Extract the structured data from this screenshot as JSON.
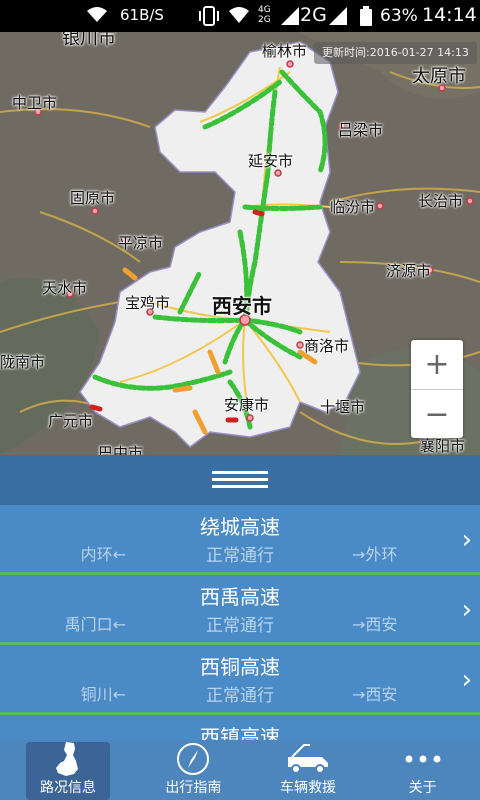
{
  "status_bar": {
    "net_speed": "61B/S",
    "network": "2G",
    "net_small": "4G\n2G",
    "battery": "63%",
    "time": "14:14"
  },
  "map": {
    "update_label": "更新时间:2016-01-27 14:13",
    "cities": [
      {
        "name": "银川市"
      },
      {
        "name": "榆林市"
      },
      {
        "name": "太原市"
      },
      {
        "name": "中卫市"
      },
      {
        "name": "吕梁市"
      },
      {
        "name": "延安市"
      },
      {
        "name": "固原市"
      },
      {
        "name": "临汾市"
      },
      {
        "name": "长治市"
      },
      {
        "name": "平凉市"
      },
      {
        "name": "济源市"
      },
      {
        "name": "天水市"
      },
      {
        "name": "宝鸡市"
      },
      {
        "name": "西安市"
      },
      {
        "name": "商洛市"
      },
      {
        "name": "陇南市"
      },
      {
        "name": "十堰市"
      },
      {
        "name": "安康市"
      },
      {
        "name": "广元市"
      },
      {
        "name": "巴中市"
      },
      {
        "name": "襄阳市"
      }
    ],
    "zoom_in": "+",
    "zoom_out": "−"
  },
  "roads": [
    {
      "name": "绕城高速",
      "from": "内环",
      "state": "正常通行",
      "to": "外环"
    },
    {
      "name": "西禹高速",
      "from": "禹门口",
      "state": "正常通行",
      "to": "西安"
    },
    {
      "name": "西铜高速",
      "from": "铜川",
      "state": "正常通行",
      "to": "西安"
    },
    {
      "name": "西镇高速",
      "from": "",
      "state": "",
      "to": ""
    }
  ],
  "tabs": [
    {
      "label": "路况信息",
      "icon": "shaanxi-map-icon",
      "active": true
    },
    {
      "label": "出行指南",
      "icon": "compass-icon",
      "active": false
    },
    {
      "label": "车辆救援",
      "icon": "tow-truck-icon",
      "active": false
    },
    {
      "label": "关于",
      "icon": "more-dots-icon",
      "active": false
    }
  ],
  "colors": {
    "accent": "#4a8ac6",
    "road_ok": "#39c13a",
    "road_slow": "#f0a030",
    "road_jam": "#d02020"
  }
}
